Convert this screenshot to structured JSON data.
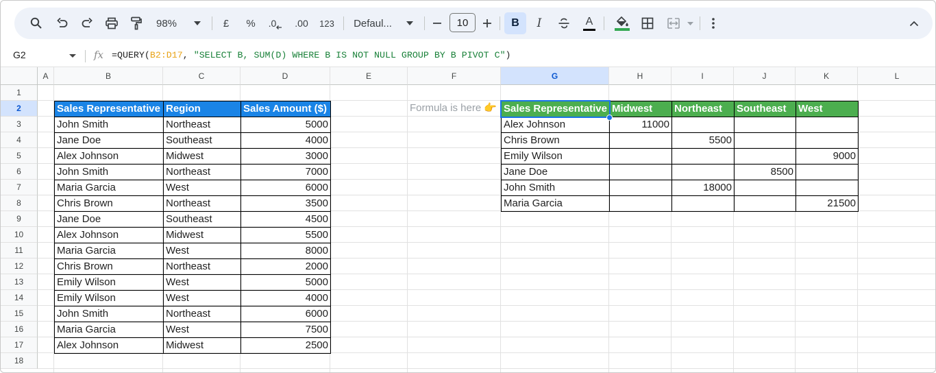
{
  "toolbar": {
    "zoom": "98%",
    "currency": "£",
    "percent": "%",
    "dec_decrease": ".0",
    "dec_increase": ".00",
    "format_more": "123",
    "font": "Defaul...",
    "font_size": "10",
    "bold": "B",
    "italic": "I",
    "text_color": "A",
    "fill_color_hex": "#34a853"
  },
  "formula_bar": {
    "name_box": "G2",
    "fx": "fx",
    "formula_prefix": "=QUERY(",
    "formula_ref": "B2:D17",
    "formula_comma": ", ",
    "formula_string": "\"SELECT B, SUM(D) WHERE B IS NOT NULL GROUP BY B PIVOT C\"",
    "formula_suffix": ")"
  },
  "columns": [
    "A",
    "B",
    "C",
    "D",
    "E",
    "F",
    "G",
    "H",
    "I",
    "J",
    "K",
    "L"
  ],
  "rows": [
    "1",
    "2",
    "3",
    "4",
    "5",
    "6",
    "7",
    "8",
    "9",
    "10",
    "11",
    "12",
    "13",
    "14",
    "15",
    "16",
    "17",
    "18"
  ],
  "source_table": {
    "headers": [
      "Sales Representative",
      "Region",
      "Sales Amount ($)"
    ],
    "rows": [
      [
        "John Smith",
        "Northeast",
        "5000"
      ],
      [
        "Jane Doe",
        "Southeast",
        "4000"
      ],
      [
        "Alex Johnson",
        "Midwest",
        "3000"
      ],
      [
        "John Smith",
        "Northeast",
        "7000"
      ],
      [
        "Maria Garcia",
        "West",
        "6000"
      ],
      [
        "Chris Brown",
        "Northeast",
        "3500"
      ],
      [
        "Jane Doe",
        "Southeast",
        "4500"
      ],
      [
        "Alex Johnson",
        "Midwest",
        "5500"
      ],
      [
        "Maria Garcia",
        "West",
        "8000"
      ],
      [
        "Chris Brown",
        "Northeast",
        "2000"
      ],
      [
        "Emily Wilson",
        "West",
        "5000"
      ],
      [
        "Emily Wilson",
        "West",
        "4000"
      ],
      [
        "John Smith",
        "Northeast",
        "6000"
      ],
      [
        "Maria Garcia",
        "West",
        "7500"
      ],
      [
        "Alex Johnson",
        "Midwest",
        "2500"
      ]
    ]
  },
  "note": "Formula is here 👉",
  "pivot_table": {
    "headers": [
      "Sales Representative",
      "Midwest",
      "Northeast",
      "Southeast",
      "West"
    ],
    "rows": [
      [
        "Alex Johnson",
        "11000",
        "",
        "",
        ""
      ],
      [
        "Chris Brown",
        "",
        "5500",
        "",
        ""
      ],
      [
        "Emily Wilson",
        "",
        "",
        "",
        "9000"
      ],
      [
        "Jane Doe",
        "",
        "",
        "8500",
        ""
      ],
      [
        "John Smith",
        "",
        "18000",
        "",
        ""
      ],
      [
        "Maria Garcia",
        "",
        "",
        "",
        "21500"
      ]
    ]
  },
  "colors": {
    "source_header": "#1a84e6",
    "pivot_header": "#4cae4f",
    "selection": "#1a73e8"
  }
}
